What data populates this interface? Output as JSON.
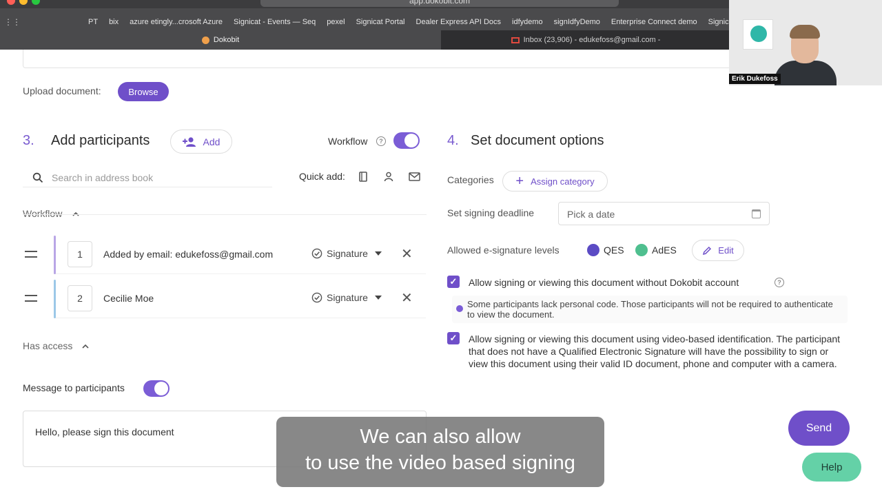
{
  "browser": {
    "url": "app.dokobit.com",
    "bookmarks": [
      "PT",
      "bix",
      "azure etingly...crosoft Azure",
      "Signicat - Events — Seq",
      "pexel",
      "Signicat Portal",
      "Dealer Express API Docs",
      "idfydemo",
      "signIdfyDemo",
      "Enterprise Connect demo",
      "Signicat Sign d"
    ],
    "tabs": [
      {
        "label": "Dokobit",
        "active": true
      },
      {
        "label": "Inbox (23,906) - edukefoss@gmail.com -",
        "active": false
      }
    ]
  },
  "upload": {
    "label": "Upload document:",
    "button": "Browse"
  },
  "participants": {
    "num": "3.",
    "title": "Add participants",
    "add_button": "Add",
    "workflow_label": "Workflow",
    "search_placeholder": "Search in address book",
    "quick_add": "Quick add:",
    "workflow_section": "Workflow",
    "list": [
      {
        "order": "1",
        "name": "Added by email: edukefoss@gmail.com",
        "role": "Signature",
        "bar_color": "#b9a6e6"
      },
      {
        "order": "2",
        "name": "Cecilie Moe",
        "role": "Signature",
        "bar_color": "#9cc8e8"
      }
    ],
    "has_access": "Has access",
    "message_label": "Message to participants",
    "message_text": "Hello, please sign this document"
  },
  "options": {
    "num": "4.",
    "title": "Set document options",
    "categories_label": "Categories",
    "assign_category": "Assign category",
    "deadline_label": "Set signing deadline",
    "deadline_placeholder": "Pick a date",
    "esig_label": "Allowed e-signature levels",
    "levels": [
      {
        "label": "QES",
        "color": "#5b4bc4"
      },
      {
        "label": "AdES",
        "color": "#4fbf8f"
      }
    ],
    "edit": "Edit",
    "allow_no_account": "Allow signing or viewing this document without Dokobit account",
    "notice": "Some participants lack personal code. Those participants will not be required to authenticate to view the document.",
    "allow_video": "Allow signing or viewing this document using video-based identification. The participant that does not have a Qualified Electronic Signature will have the possibility to sign or view this document using their valid ID document, phone and computer with a camera."
  },
  "actions": {
    "send": "Send",
    "help": "Help"
  },
  "caption": {
    "line1": "We can also allow",
    "line2": "to use the video based signing"
  },
  "video_overlay": {
    "name": "Erik Dukefoss"
  },
  "colors": {
    "accent": "#6f4fc9",
    "help": "#64d1a7"
  }
}
